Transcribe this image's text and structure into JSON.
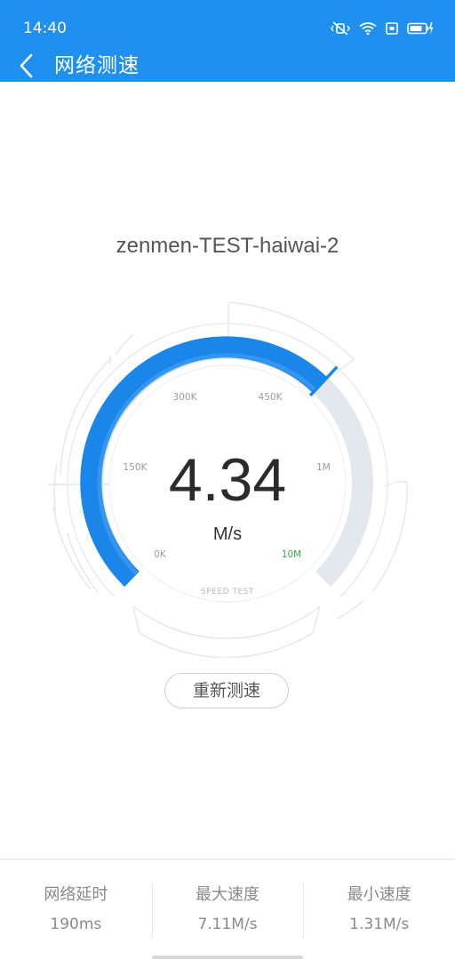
{
  "status_bar": {
    "time": "14:40",
    "icons": [
      "vibrate-mute-icon",
      "wifi-icon",
      "sim-icon",
      "battery-charging-icon"
    ]
  },
  "header": {
    "title": "网络测速",
    "back_icon": "back-arrow-icon"
  },
  "network": {
    "name": "zenmen-TEST-haiwai-2"
  },
  "gauge": {
    "value": "4.34",
    "unit": "M/s",
    "caption": "SPEED TEST",
    "scale_labels": [
      "0K",
      "150K",
      "300K",
      "450K",
      "1M",
      "10M"
    ],
    "scale_colors": [
      "#9a9a9a",
      "#9a9a9a",
      "#9a9a9a",
      "#9a9a9a",
      "#9a9a9a",
      "#3aa54a"
    ],
    "fill_fraction": 0.66
  },
  "actions": {
    "retest_label": "重新测速"
  },
  "stats": [
    {
      "label": "网络延时",
      "value": "190ms"
    },
    {
      "label": "最大速度",
      "value": "7.11M/s"
    },
    {
      "label": "最小速度",
      "value": "1.31M/s"
    }
  ],
  "colors": {
    "brand": "#1f8ff0",
    "gauge_fill": "#1b86ea",
    "gauge_track": "#e3e8ee",
    "gauge_needle": "#1b86ea"
  }
}
